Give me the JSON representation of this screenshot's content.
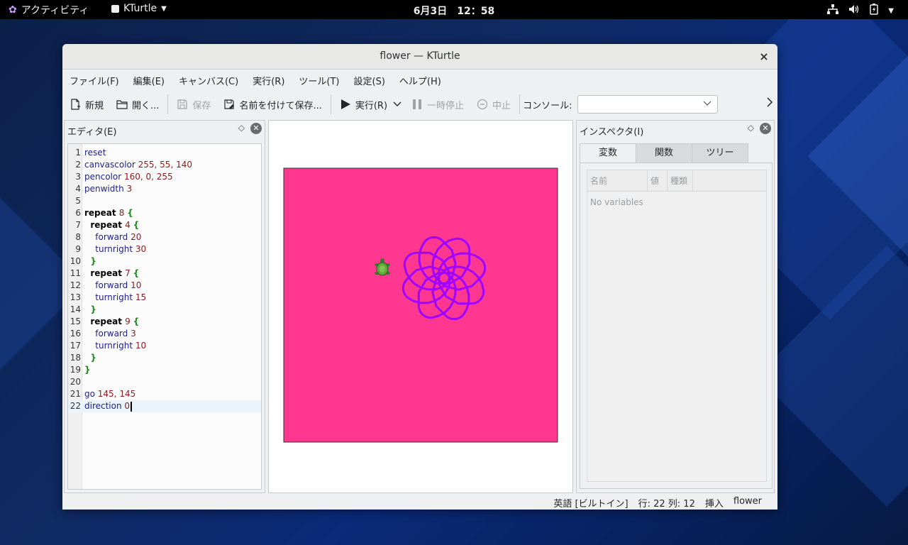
{
  "topbar": {
    "activities": "アクティビティ",
    "app_name": "KTurtle",
    "clock": "6月3日　12：58"
  },
  "window": {
    "title": "flower — KTurtle",
    "close": "×"
  },
  "menubar": [
    "ファイル(F)",
    "編集(E)",
    "キャンバス(C)",
    "実行(R)",
    "ツール(T)",
    "設定(S)",
    "ヘルプ(H)"
  ],
  "toolbar": {
    "new": "新規",
    "open": "開く...",
    "save": "保存",
    "save_as": "名前を付けて保存...",
    "run": "実行(R)",
    "pause": "一時停止",
    "abort": "中止",
    "console_label": "コンソール:",
    "console_value": ""
  },
  "editor": {
    "title": "エディタ(E)",
    "current_line": 22,
    "lines": [
      {
        "n": "1",
        "parts": [
          {
            "t": "reset",
            "c": "cmd"
          }
        ]
      },
      {
        "n": "2",
        "parts": [
          {
            "t": "canvascolor ",
            "c": "cmd"
          },
          {
            "t": "255, 55, 140",
            "c": "num"
          }
        ]
      },
      {
        "n": "3",
        "parts": [
          {
            "t": "pencolor ",
            "c": "cmd"
          },
          {
            "t": "160, 0, 255",
            "c": "num"
          }
        ]
      },
      {
        "n": "4",
        "parts": [
          {
            "t": "penwidth ",
            "c": "cmd"
          },
          {
            "t": "3",
            "c": "num"
          }
        ]
      },
      {
        "n": "5",
        "parts": []
      },
      {
        "n": "6",
        "parts": [
          {
            "t": "repeat ",
            "c": "kw"
          },
          {
            "t": "8 ",
            "c": "num"
          },
          {
            "t": "{",
            "c": "br"
          }
        ]
      },
      {
        "n": "7",
        "parts": [
          {
            "t": "  repeat ",
            "c": "kw"
          },
          {
            "t": "4 ",
            "c": "num"
          },
          {
            "t": "{",
            "c": "br"
          }
        ]
      },
      {
        "n": "8",
        "parts": [
          {
            "t": "    forward ",
            "c": "cmd"
          },
          {
            "t": "20",
            "c": "num"
          }
        ]
      },
      {
        "n": "9",
        "parts": [
          {
            "t": "    turnright ",
            "c": "cmd"
          },
          {
            "t": "30",
            "c": "num"
          }
        ]
      },
      {
        "n": "10",
        "parts": [
          {
            "t": "  }",
            "c": "br"
          }
        ]
      },
      {
        "n": "11",
        "parts": [
          {
            "t": "  repeat ",
            "c": "kw"
          },
          {
            "t": "7 ",
            "c": "num"
          },
          {
            "t": "{",
            "c": "br"
          }
        ]
      },
      {
        "n": "12",
        "parts": [
          {
            "t": "    forward ",
            "c": "cmd"
          },
          {
            "t": "10",
            "c": "num"
          }
        ]
      },
      {
        "n": "13",
        "parts": [
          {
            "t": "    turnright ",
            "c": "cmd"
          },
          {
            "t": "15",
            "c": "num"
          }
        ]
      },
      {
        "n": "14",
        "parts": [
          {
            "t": "  }",
            "c": "br"
          }
        ]
      },
      {
        "n": "15",
        "parts": [
          {
            "t": "  repeat ",
            "c": "kw"
          },
          {
            "t": "9 ",
            "c": "num"
          },
          {
            "t": "{",
            "c": "br"
          }
        ]
      },
      {
        "n": "16",
        "parts": [
          {
            "t": "    forward ",
            "c": "cmd"
          },
          {
            "t": "3",
            "c": "num"
          }
        ]
      },
      {
        "n": "17",
        "parts": [
          {
            "t": "    turnright ",
            "c": "cmd"
          },
          {
            "t": "10",
            "c": "num"
          }
        ]
      },
      {
        "n": "18",
        "parts": [
          {
            "t": "  }",
            "c": "br"
          }
        ]
      },
      {
        "n": "19",
        "parts": [
          {
            "t": "}",
            "c": "br"
          }
        ]
      },
      {
        "n": "20",
        "parts": []
      },
      {
        "n": "21",
        "parts": [
          {
            "t": "go ",
            "c": "cmd"
          },
          {
            "t": "145, 145",
            "c": "num"
          }
        ]
      },
      {
        "n": "22",
        "parts": [
          {
            "t": "direction ",
            "c": "cmd"
          },
          {
            "t": "0",
            "c": "num"
          }
        ]
      }
    ]
  },
  "canvas": {
    "canvas_color": "#ff3790",
    "pen_color": "#a000ff",
    "icon": "turtle-icon"
  },
  "inspector": {
    "title": "インスペクタ(I)",
    "tabs": [
      "変数",
      "関数",
      "ツリー"
    ],
    "active_tab": 0,
    "columns": [
      "名前",
      "値",
      "種類"
    ],
    "empty_text": "No variables"
  },
  "statusbar": {
    "language": "英語 [ビルトイン]",
    "position": "行: 22 列: 12",
    "mode": "挿入",
    "file": "flower"
  }
}
